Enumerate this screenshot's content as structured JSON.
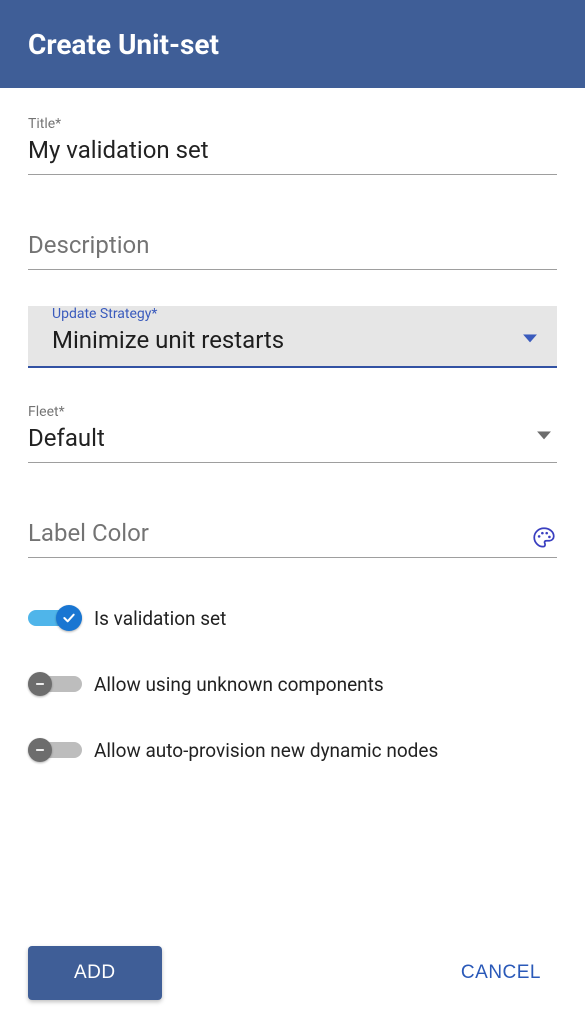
{
  "header": {
    "title": "Create Unit-set"
  },
  "fields": {
    "title": {
      "label": "Title*",
      "value": "My validation set"
    },
    "description": {
      "placeholder": "Description",
      "value": ""
    },
    "update_strategy": {
      "label": "Update Strategy*",
      "value": "Minimize unit restarts"
    },
    "fleet": {
      "label": "Fleet*",
      "value": "Default"
    },
    "label_color": {
      "placeholder": "Label Color",
      "value": ""
    }
  },
  "toggles": {
    "is_validation_set": {
      "label": "Is validation set",
      "on": true
    },
    "allow_unknown_components": {
      "label": "Allow using unknown components",
      "on": false
    },
    "allow_auto_provision": {
      "label": "Allow auto-provision new dynamic nodes",
      "on": false
    }
  },
  "actions": {
    "add": "ADD",
    "cancel": "CANCEL"
  }
}
